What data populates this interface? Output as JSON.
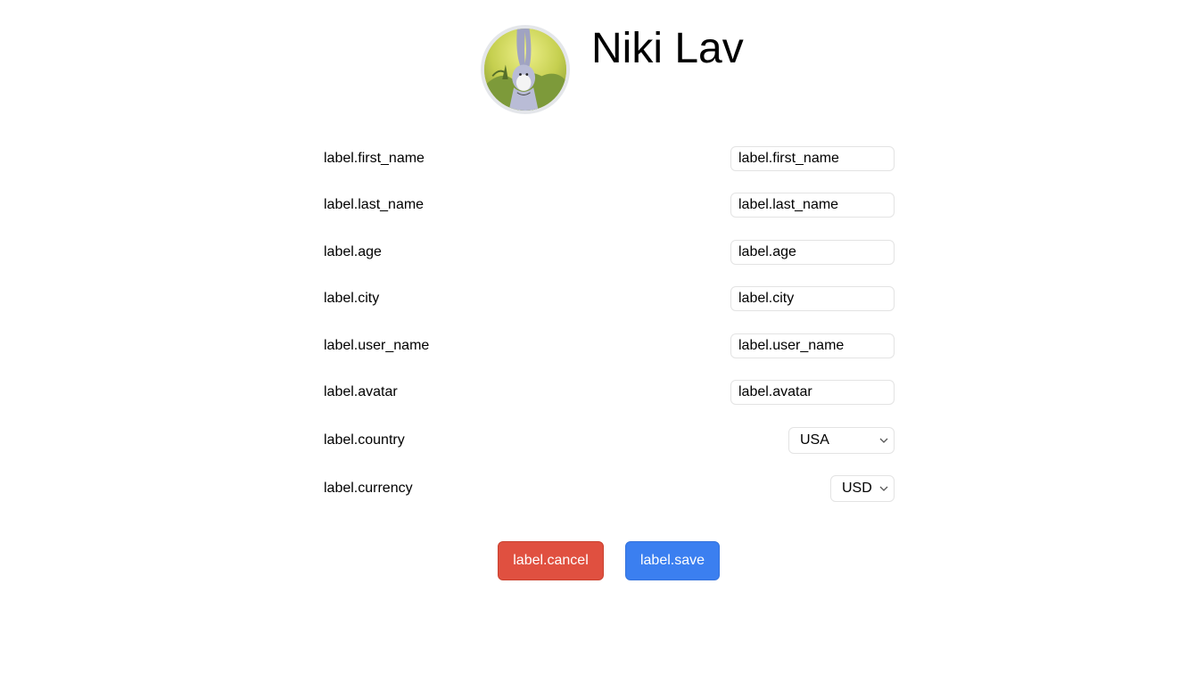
{
  "profile": {
    "name": "Niki Lav"
  },
  "form": {
    "first_name": {
      "label": "label.first_name",
      "value": "label.first_name"
    },
    "last_name": {
      "label": "label.last_name",
      "value": "label.last_name"
    },
    "age": {
      "label": "label.age",
      "value": "label.age"
    },
    "city": {
      "label": "label.city",
      "value": "label.city"
    },
    "user_name": {
      "label": "label.user_name",
      "value": "label.user_name"
    },
    "avatar": {
      "label": "label.avatar",
      "value": "label.avatar"
    },
    "country": {
      "label": "label.country",
      "value": "USA"
    },
    "currency": {
      "label": "label.currency",
      "value": "USD"
    }
  },
  "actions": {
    "cancel_label": "label.cancel",
    "save_label": "label.save"
  },
  "colors": {
    "cancel": "#e05040",
    "save": "#3b7ff0"
  },
  "icons": {
    "select_chevron": "chevron-down-icon",
    "avatar": "avatar-image"
  }
}
